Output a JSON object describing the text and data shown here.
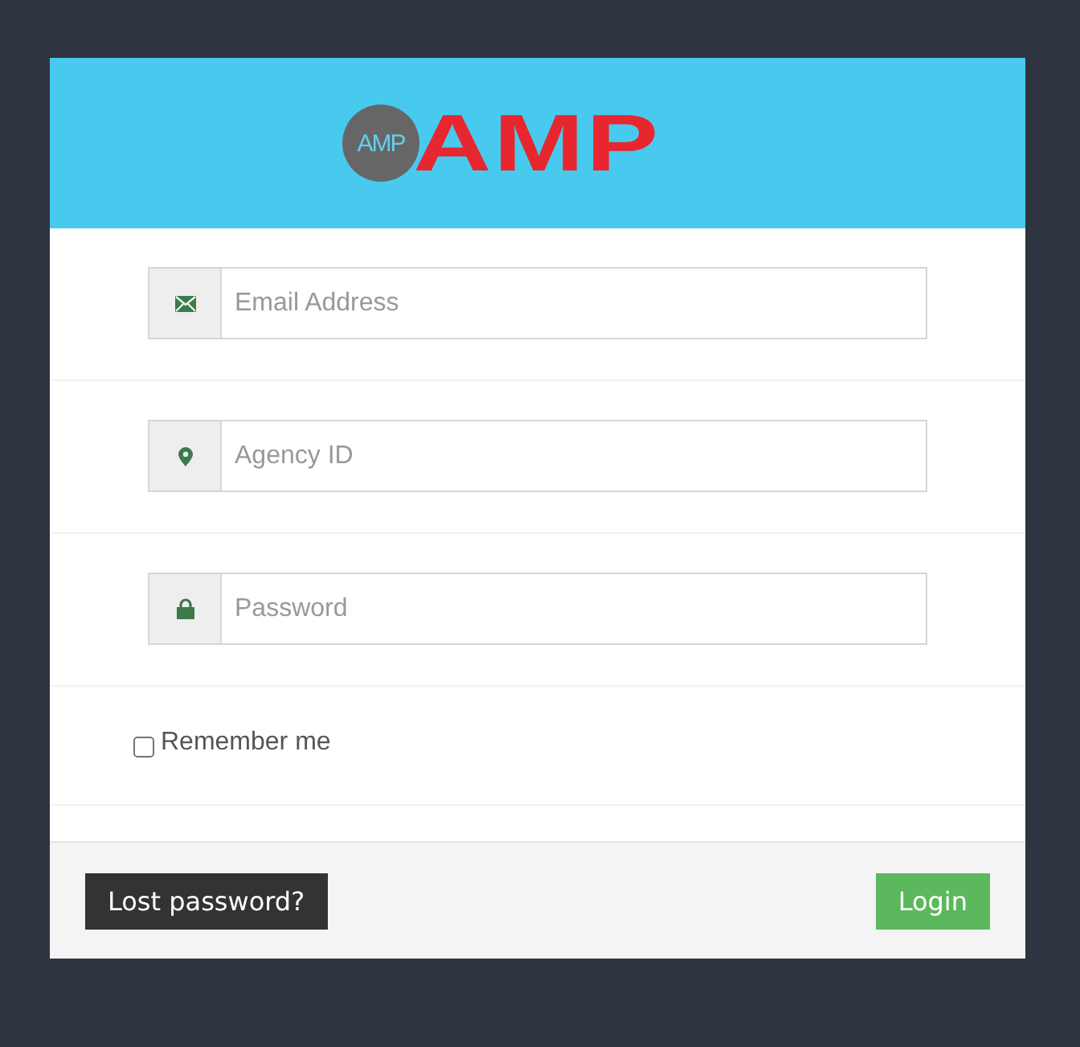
{
  "logo": {
    "badge": "AMP",
    "wordmark": "AMP"
  },
  "fields": [
    {
      "kind": "email",
      "placeholder": "Email Address"
    },
    {
      "kind": "location",
      "placeholder": "Agency ID"
    },
    {
      "kind": "password",
      "placeholder": "Password"
    }
  ],
  "remember": {
    "label": "Remember me",
    "checked": false
  },
  "buttons": [
    {
      "kind": "secondary",
      "label": "Lost password?"
    },
    {
      "kind": "primary",
      "label": "Login"
    }
  ]
}
